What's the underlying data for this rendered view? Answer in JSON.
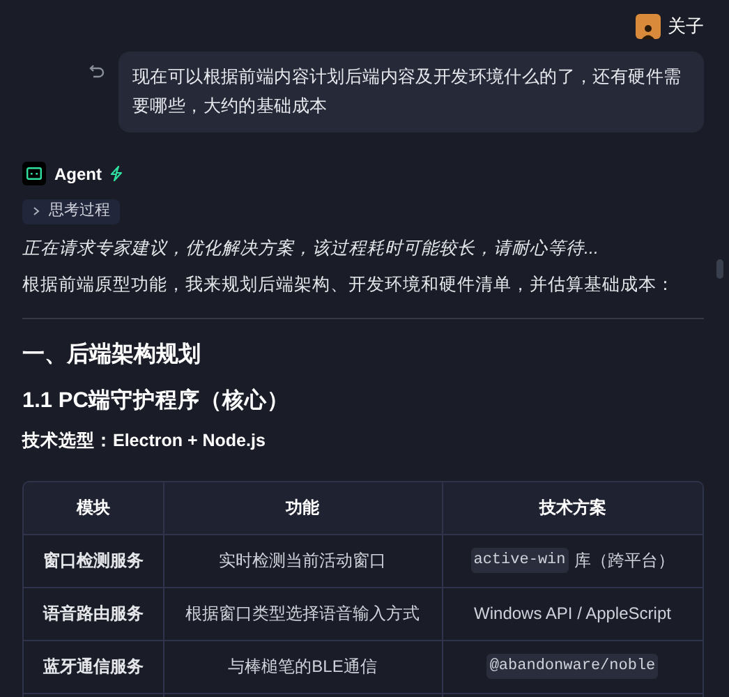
{
  "user": {
    "name": "关子"
  },
  "user_message": {
    "text": "现在可以根据前端内容计划后端内容及开发环境什么的了，还有硬件需要哪些，大约的基础成本"
  },
  "agent": {
    "name": "Agent"
  },
  "thinking": {
    "label": "思考过程",
    "expanded": false
  },
  "status_text": "正在请求专家建议，优化解决方案，该过程耗时可能较长，请耐心等待...",
  "intro": "根据前端原型功能，我来规划后端架构、开发环境和硬件清单，并估算基础成本：",
  "heading_1": "一、后端架构规划",
  "heading_2": "1.1 PC端守护程序（核心）",
  "tech_choice": "技术选型：Electron + Node.js",
  "table": {
    "columns": [
      "模块",
      "功能",
      "技术方案"
    ],
    "rows": [
      {
        "module": "窗口检测服务",
        "function": "实时检测当前活动窗口",
        "tech": [
          {
            "kind": "code",
            "text": "active-win"
          },
          {
            "kind": "text",
            "text": "库（跨平台）"
          }
        ]
      },
      {
        "module": "语音路由服务",
        "function": "根据窗口类型选择语音输入方式",
        "tech": [
          {
            "kind": "text",
            "text": "Windows API / AppleScript"
          }
        ]
      },
      {
        "module": "蓝牙通信服务",
        "function": "与棒槌笔的BLE通信",
        "tech": [
          {
            "kind": "code",
            "text": "@abandonware/noble"
          }
        ]
      }
    ]
  }
}
